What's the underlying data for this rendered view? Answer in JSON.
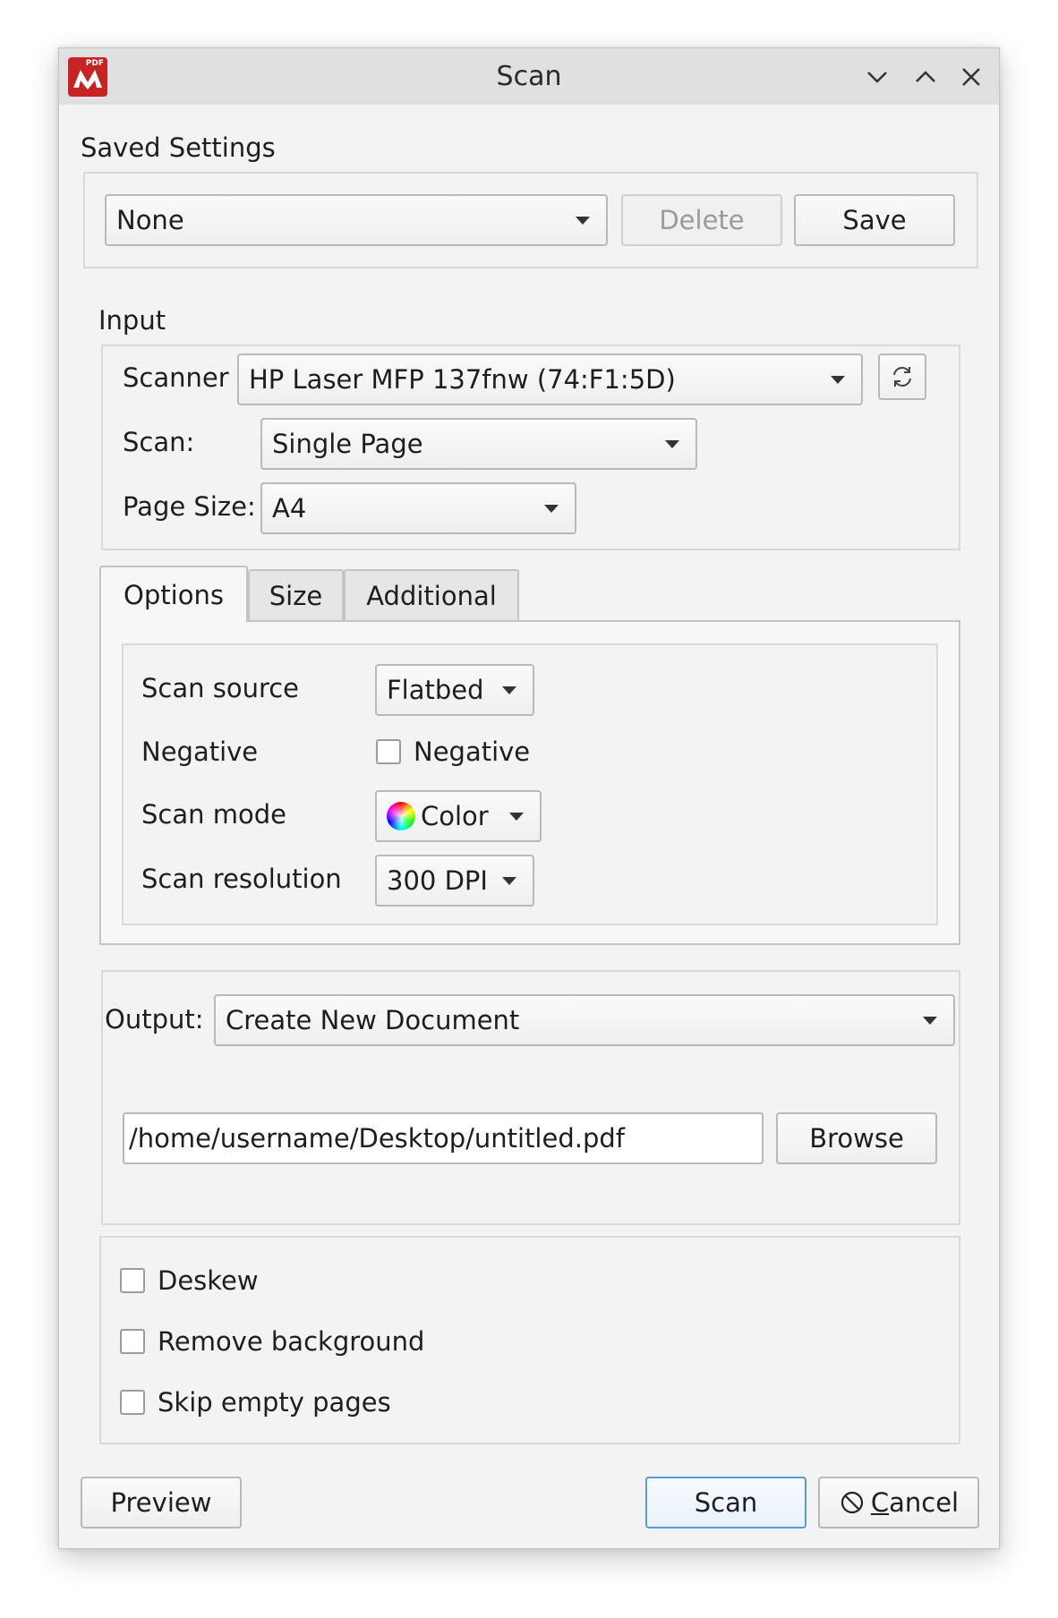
{
  "window": {
    "title": "Scan",
    "app_icon_text": "PDF"
  },
  "saved_settings": {
    "heading": "Saved Settings",
    "selected": "None",
    "delete_label": "Delete",
    "save_label": "Save"
  },
  "input": {
    "heading": "Input",
    "scanner_label": "Scanner",
    "scanner_value": "HP Laser MFP 137fnw (74:F1:5D)",
    "scan_label": "Scan:",
    "scan_value": "Single Page",
    "page_size_label": "Page Size:",
    "page_size_value": "A4"
  },
  "tabs": [
    {
      "label": "Options",
      "active": true
    },
    {
      "label": "Size",
      "active": false
    },
    {
      "label": "Additional",
      "active": false
    }
  ],
  "options": {
    "scan_source_label": "Scan source",
    "scan_source_value": "Flatbed",
    "negative_label": "Negative",
    "negative_checkbox_label": "Negative",
    "negative_checked": false,
    "scan_mode_label": "Scan mode",
    "scan_mode_value": "Color",
    "scan_resolution_label": "Scan resolution",
    "scan_resolution_value": "300 DPI"
  },
  "output": {
    "label": "Output:",
    "value": "Create New Document",
    "path": "/home/username/Desktop/untitled.pdf",
    "browse_label": "Browse"
  },
  "processing": {
    "deskew_label": "Deskew",
    "remove_background_label": "Remove background",
    "skip_empty_label": "Skip empty pages"
  },
  "footer": {
    "preview_label": "Preview",
    "scan_label": "Scan",
    "cancel_mnemonic": "C",
    "cancel_rest": "ancel"
  }
}
